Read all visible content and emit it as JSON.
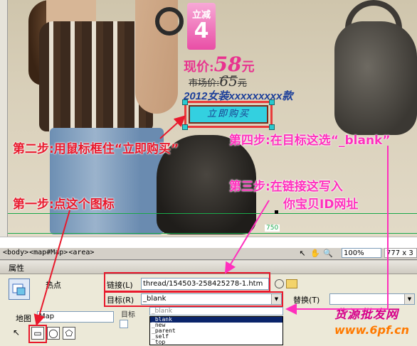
{
  "promo": {
    "badge_line1": "立减",
    "badge_line2": "4",
    "now_price_label": "现价:",
    "now_price_value": "58",
    "now_price_unit": "元",
    "old_price_label": "市场价:",
    "old_price_value": "65",
    "old_price_unit": "元",
    "product_name": "2012女装xxxxxxxxx款",
    "buy_button": "立即购买"
  },
  "annotations": {
    "step1": "第一步:点这个图标",
    "step2": "第二步:用鼠标框住“立即购买”",
    "step3_line1": "第三步:在链接这写入",
    "step3_line2": "你宝贝ID网址",
    "step4": "第四步:在目标这选“_blank”"
  },
  "canvas": {
    "width_label": "750"
  },
  "statusbar": {
    "tags": [
      "<body>",
      "<map#Map>",
      "<area>"
    ],
    "zoom": "100%",
    "dimensions": "777 x 3"
  },
  "properties": {
    "panel_title": "属性",
    "hotspot_label": "热点",
    "link_label": "链接(L)",
    "link_value": "thread/154503-258425278-1.htm",
    "target_label": "目标(R)",
    "target_value": "_blank",
    "replace_label": "替换(T)",
    "map_label": "地图",
    "map_value": "Map",
    "target2_label": "目标",
    "target2_value": "_blank",
    "target_options": [
      "_blank",
      "_new",
      "_parent",
      "_self",
      "_top"
    ]
  },
  "watermark": {
    "line1": "货源批发网",
    "line2": "www.6pf.cn"
  },
  "colors": {
    "annotation_red": "#e8192c",
    "annotation_magenta": "#ff2fbd",
    "price_pink": "#e8338f",
    "button_cyan": "#33d0e0",
    "guide_green": "#1aa84a"
  }
}
